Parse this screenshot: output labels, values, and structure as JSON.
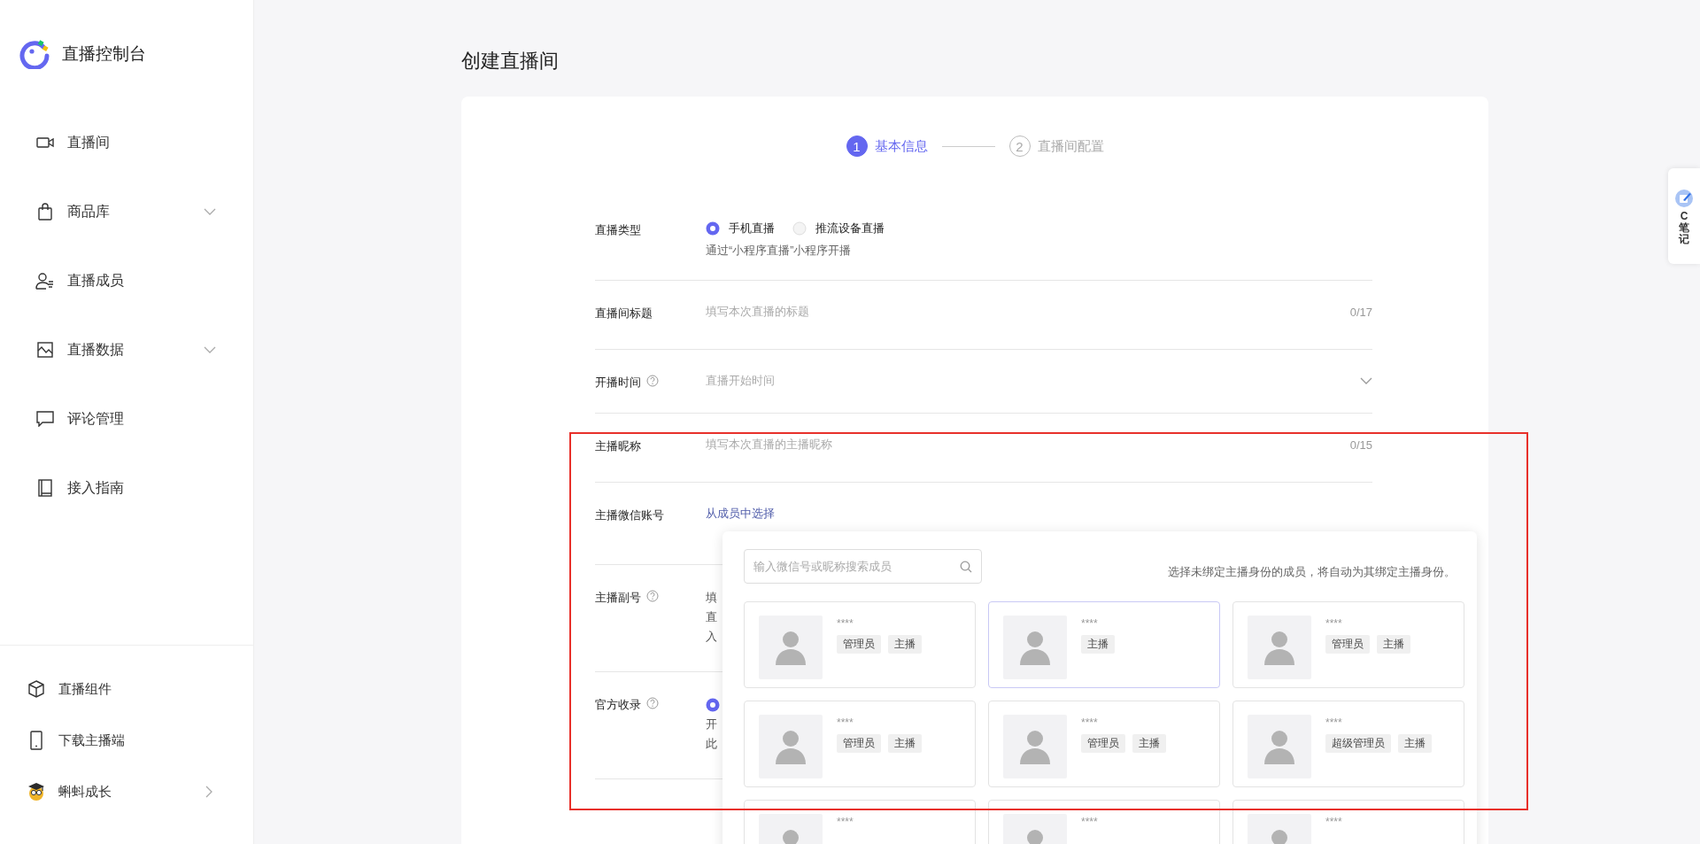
{
  "sidebar": {
    "brand": "直播控制台",
    "items": [
      {
        "label": "直播间",
        "has_submenu": false
      },
      {
        "label": "商品库",
        "has_submenu": true
      },
      {
        "label": "直播成员",
        "has_submenu": false
      },
      {
        "label": "直播数据",
        "has_submenu": true
      },
      {
        "label": "评论管理",
        "has_submenu": false
      },
      {
        "label": "接入指南",
        "has_submenu": false
      }
    ],
    "bottom_items": [
      {
        "label": "直播组件",
        "has_submenu": false
      },
      {
        "label": "下载主播端",
        "has_submenu": false
      },
      {
        "label": "蝌蚪成长",
        "has_submenu": true
      }
    ]
  },
  "page_title": "创建直播间",
  "steps": [
    {
      "number": "1",
      "label": "基本信息",
      "selected": true
    },
    {
      "number": "2",
      "label": "直播间配置",
      "selected": false
    }
  ],
  "form": {
    "rows": [
      {
        "kind": "radio",
        "label": "直播类型",
        "options": [
          {
            "label": "手机直播",
            "selected": true
          },
          {
            "label": "推流设备直播",
            "selected": false
          }
        ],
        "hint": "通过“小程序直播”小程序开播"
      },
      {
        "kind": "text",
        "label": "直播间标题",
        "placeholder": "填写本次直播的标题",
        "counter": "0/17"
      },
      {
        "kind": "select",
        "label": "开播时间",
        "help": true,
        "placeholder": "直播开始时间"
      },
      {
        "kind": "text",
        "label": "主播昵称",
        "placeholder": "填写本次直播的主播昵称",
        "counter": "0/15"
      },
      {
        "kind": "link",
        "label": "主播微信账号",
        "link": "从成员中选择"
      },
      {
        "kind": "covered",
        "label": "主播副号",
        "help": true,
        "lines": [
          "填",
          "直",
          "入"
        ]
      },
      {
        "kind": "covered",
        "label": "官方收录",
        "help": true,
        "radio": {
          "selected": true
        },
        "lines": [
          "开",
          "此"
        ]
      }
    ]
  },
  "member_picker": {
    "search_placeholder": "输入微信号或昵称搜索成员",
    "hint": "选择未绑定主播身份的成员，将自动为其绑定主播身份。",
    "members": [
      {
        "name": "****",
        "tags": [
          "管理员",
          "主播"
        ],
        "selected": false
      },
      {
        "name": "****",
        "tags": [
          "主播"
        ],
        "selected": true
      },
      {
        "name": "****",
        "tags": [
          "管理员",
          "主播"
        ],
        "selected": false
      },
      {
        "name": "****",
        "tags": [
          "管理员",
          "主播"
        ],
        "selected": false
      },
      {
        "name": "****",
        "tags": [
          "管理员",
          "主播"
        ],
        "selected": false
      },
      {
        "name": "****",
        "tags": [
          "超级管理员",
          "主播"
        ],
        "selected": false
      },
      {
        "name": "****",
        "selected": false
      },
      {
        "name": "****",
        "selected": false
      },
      {
        "name": "****",
        "selected": false
      }
    ]
  },
  "note_widget": {
    "label": "C笔记"
  }
}
